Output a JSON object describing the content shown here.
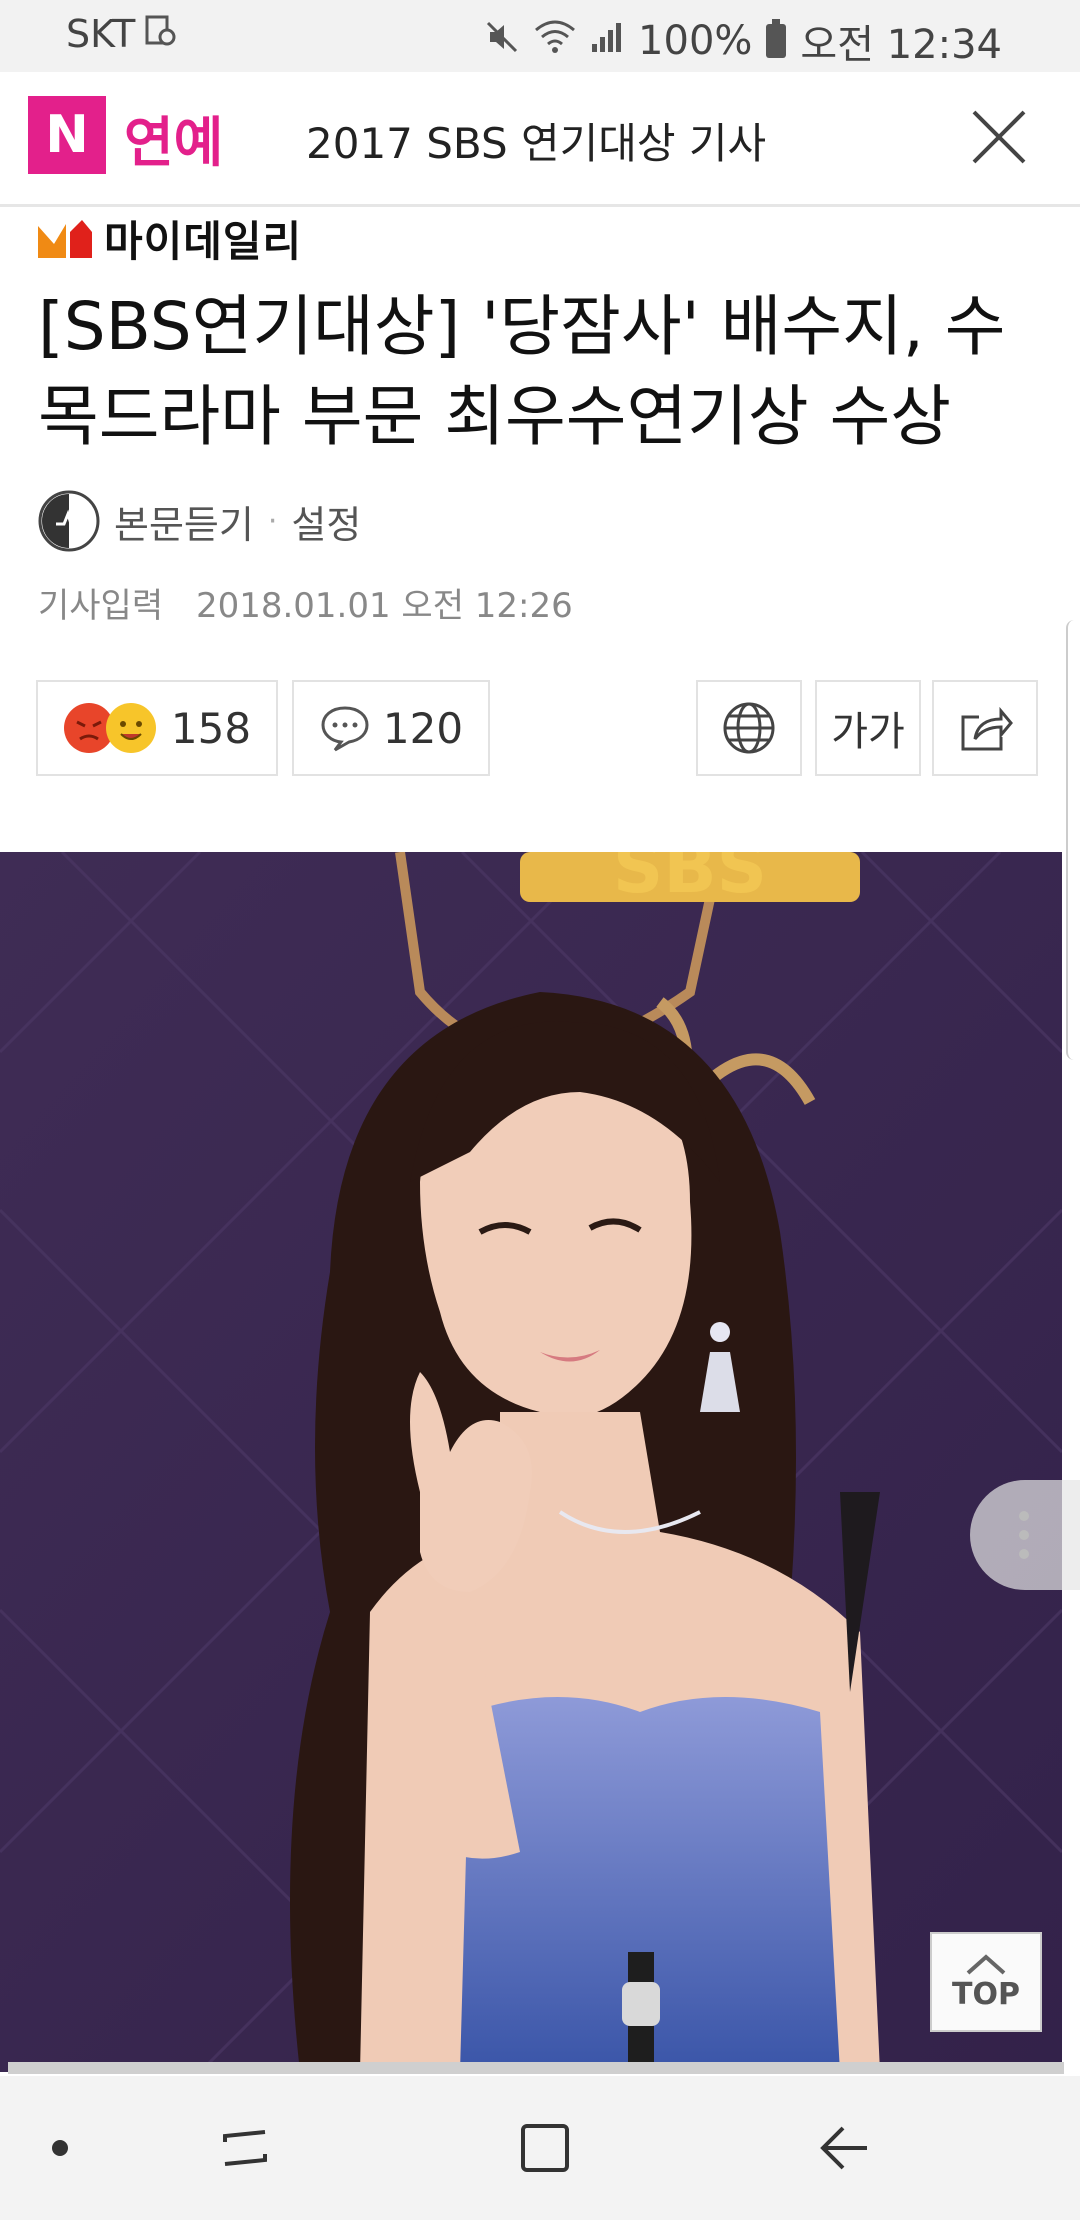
{
  "status_bar": {
    "carrier": "SKT",
    "battery": "100%",
    "time": "오전 12:34"
  },
  "header": {
    "logo": "N",
    "section": "연예",
    "title": "2017 SBS 연기대상 기사"
  },
  "article": {
    "press_name": "마이데일리",
    "headline": "[SBS연기대상] '당잠사' 배수지, 수목드라마 부문 최우수연기상 수상",
    "listen_label": "본문듣기",
    "settings_label": "설정",
    "date_label": "기사입력",
    "date_value": "2018.01.01 오전 12:26"
  },
  "actions": {
    "reactions_count": "158",
    "comments_count": "120",
    "font_label": "가가"
  },
  "photo": {
    "backdrop_text": "SBS"
  },
  "top_button": {
    "label": "TOP"
  },
  "colors": {
    "brand_pink": "#e3208b",
    "press_orange": "#f08a14",
    "photo_bg": "#3d2a52"
  }
}
